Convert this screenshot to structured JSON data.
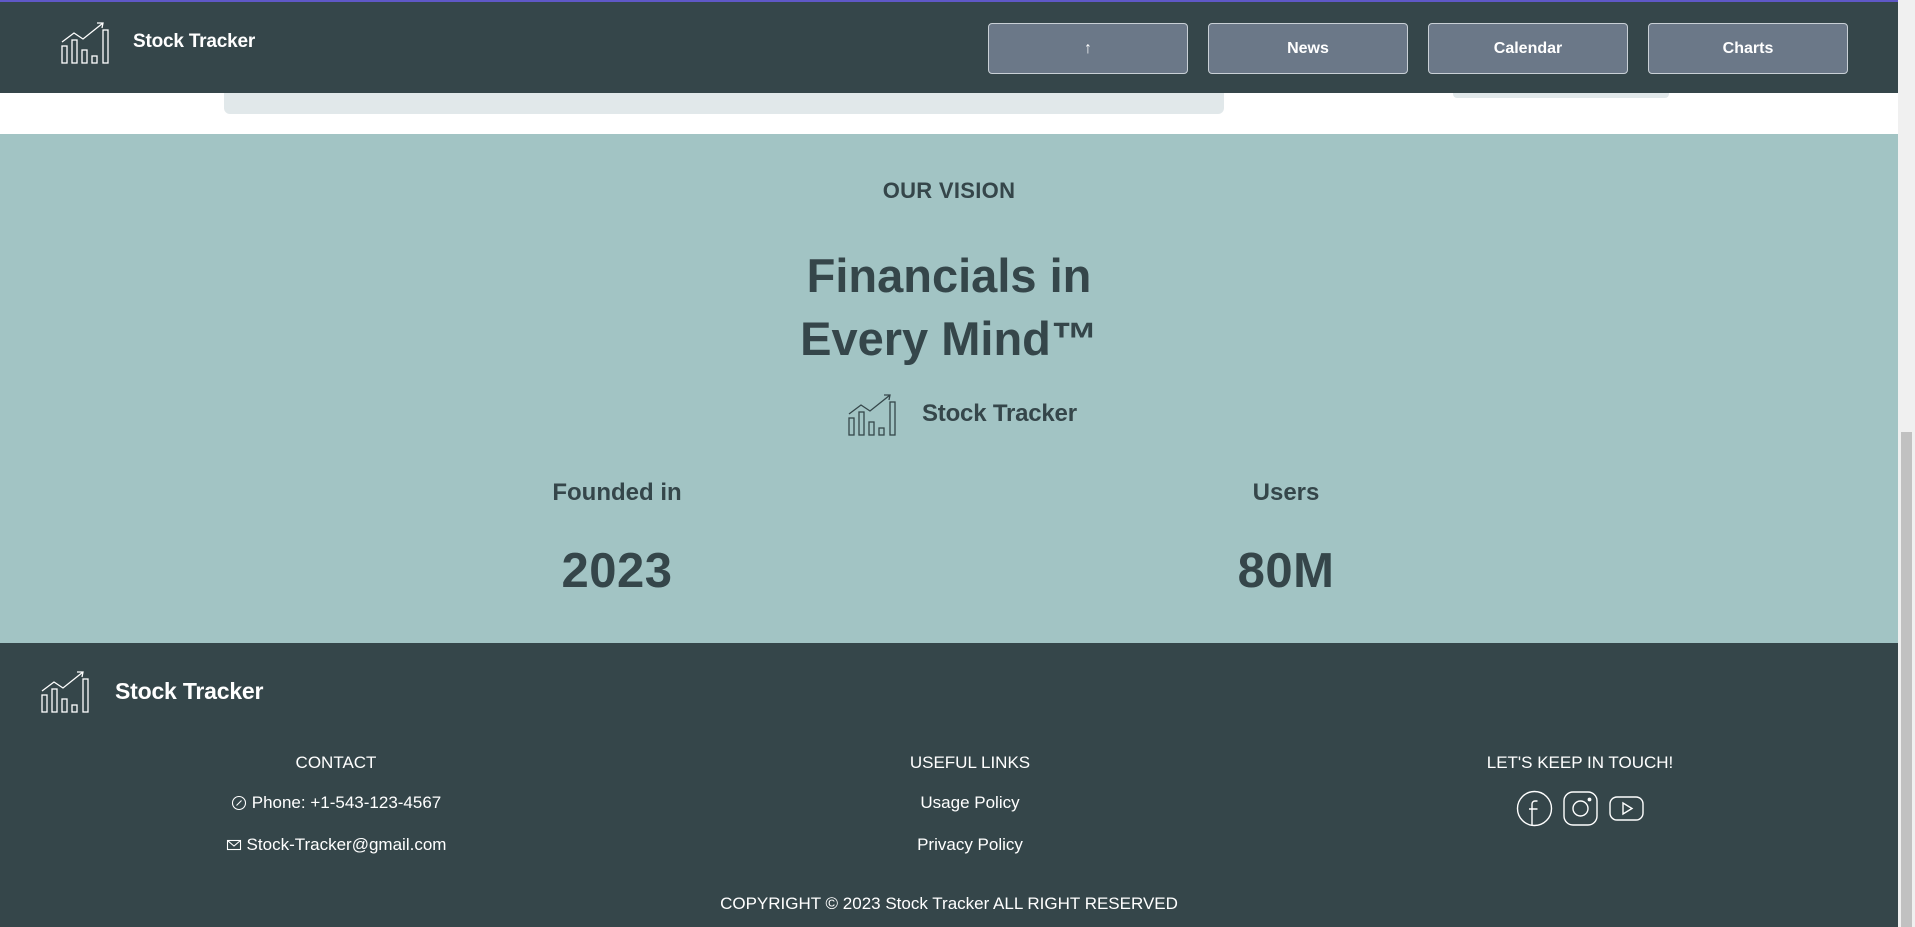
{
  "app": {
    "brand_name": "Stock Tracker",
    "logo_icon": "bar-chart-trend-icon"
  },
  "colors": {
    "navbar_bg": "#35464a",
    "nav_button_bg": "#6b7888",
    "vision_bg": "#a2c4c4",
    "footer_bg": "#35464a",
    "accent_top_line": "#5f58c7"
  },
  "nav": {
    "buttons": [
      {
        "label": "↑",
        "icon": "arrow-up-icon"
      },
      {
        "label": "News"
      },
      {
        "label": "Calendar"
      },
      {
        "label": "Charts"
      }
    ]
  },
  "vision": {
    "eyebrow": "OUR VISION",
    "title_line1": "Financials in",
    "title_line2": "Every Mind™",
    "brand_name": "Stock Tracker",
    "stats": [
      {
        "label": "Founded in",
        "value": "2023"
      },
      {
        "label": "Users",
        "value": "80M"
      }
    ]
  },
  "footer": {
    "brand_name": "Stock Tracker",
    "contact": {
      "heading": "CONTACT",
      "phone": "Phone: +1-543-123-4567",
      "phone_icon": "phone-icon",
      "email": "Stock-Tracker@gmail.com",
      "email_icon": "mail-icon"
    },
    "links": {
      "heading": "USEFUL LINKS",
      "items": [
        "Usage Policy",
        "Privacy Policy"
      ]
    },
    "social": {
      "heading": "LET'S KEEP IN TOUCH!",
      "icons": [
        "facebook-icon",
        "instagram-icon",
        "youtube-icon"
      ]
    },
    "copyright": "COPYRIGHT © 2023 Stock Tracker ALL RIGHT RESERVED"
  }
}
